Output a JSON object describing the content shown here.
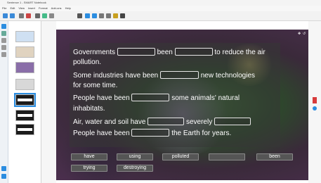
{
  "window": {
    "title": "Sentence 1 - SMART Notebook"
  },
  "menu": [
    "File",
    "Edit",
    "View",
    "Insert",
    "Format",
    "Add-ons",
    "Help"
  ],
  "colors": {
    "blank_border": "#e6e6e6",
    "selected_thumb": "#2b8de0",
    "word_bg": "#555555"
  },
  "exercise": {
    "lines": [
      {
        "parts": [
          "Governments",
          "",
          "been",
          "",
          "to reduce the air"
        ]
      },
      {
        "parts": [
          "pollution."
        ]
      },
      {
        "parts": [
          "Some industries have been",
          "",
          "new technologies"
        ]
      },
      {
        "parts": [
          "for some time."
        ]
      },
      {
        "parts": [
          "People have been",
          "",
          "some animals' natural"
        ]
      },
      {
        "parts": [
          "inhabitats."
        ]
      },
      {
        "parts": [
          "Air, water and soil have",
          "",
          "severely",
          ""
        ]
      },
      {
        "parts": [
          "People have been",
          "",
          "the Earth for years."
        ]
      }
    ]
  },
  "word_bank": [
    "have",
    "using",
    "polluted",
    "",
    "been",
    "trying",
    "destroying"
  ],
  "icons": {
    "toolbar": [
      "back-icon",
      "forward-icon",
      "add-page-icon",
      "delete-page-icon",
      "screen-shade-icon",
      "display-icon",
      "table-icon",
      "select-icon",
      "pen-icon",
      "eraser-icon",
      "line-icon",
      "shape-icon",
      "fill-icon",
      "text-icon"
    ],
    "canvas_top": [
      "move-icon",
      "reset-icon",
      "menu-icon"
    ]
  }
}
